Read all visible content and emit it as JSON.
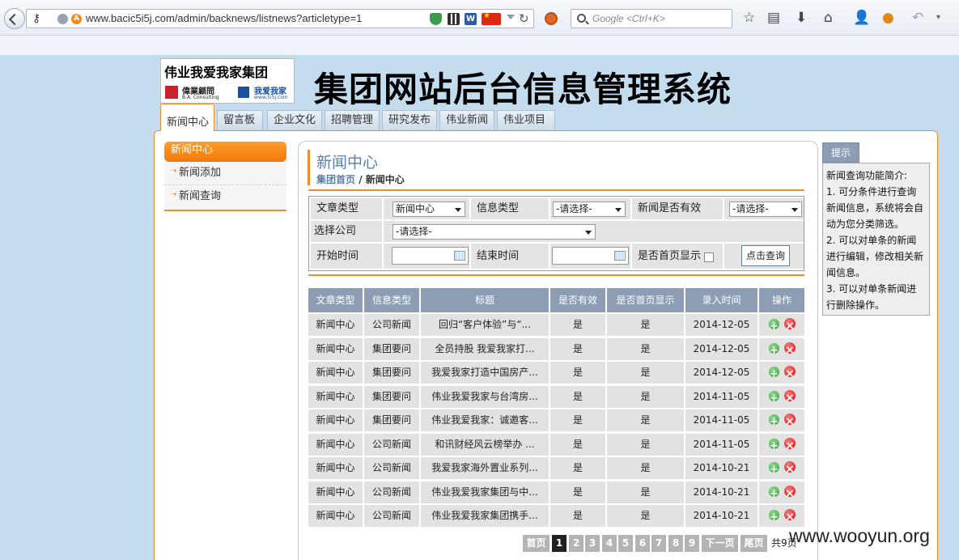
{
  "browser": {
    "url": "www.bacic5i5j.com/admin/backnews/listnews?articletype=1",
    "search_placeholder": "Google <Ctrl+K>",
    "favicon_letter": "A",
    "word_icon_letter": "W"
  },
  "logo": {
    "title": "伟业我爱我家集团",
    "brand_left": "偉業顧問",
    "brand_left_sub": "B.A. Consulting",
    "brand_right": "我爱我家",
    "brand_right_sub": "www.5i5j.com"
  },
  "site_title": "集团网站后台信息管理系统",
  "top_tabs": [
    "新闻中心",
    "留言板",
    "企业文化",
    "招聘管理",
    "研究发布",
    "伟业新闻",
    "伟业项目"
  ],
  "left_menu": {
    "header": "新闻中心",
    "items": [
      "新闻添加",
      "新闻查询"
    ]
  },
  "panel": {
    "title": "新闻中心",
    "breadcrumb_home": "集团首页",
    "breadcrumb_sep": " / ",
    "breadcrumb_current": "新闻中心"
  },
  "filter": {
    "article_type_label": "文章类型",
    "article_type_value": "新闻中心",
    "info_type_label": "信息类型",
    "info_type_value": "-请选择-",
    "valid_label": "新闻是否有效",
    "valid_value": "-请选择-",
    "company_label": "选择公司",
    "company_value": "-请选择-",
    "start_label": "开始时间",
    "start_value": "",
    "end_label": "结束时间",
    "end_value": "",
    "homepage_label": "是否首页显示",
    "homepage_checked": false,
    "query_button": "点击查询"
  },
  "table": {
    "columns": [
      "文章类型",
      "信息类型",
      "标题",
      "是否有效",
      "是否首页显示",
      "录入时间",
      "操作"
    ],
    "rows": [
      [
        "新闻中心",
        "公司新闻",
        "回归“客户体验”与“...",
        "是",
        "是",
        "2014-12-05"
      ],
      [
        "新闻中心",
        "集团要问",
        "全员持股 我爱我家打...",
        "是",
        "是",
        "2014-12-05"
      ],
      [
        "新闻中心",
        "集团要问",
        "我爱我家打造中国房产...",
        "是",
        "是",
        "2014-12-05"
      ],
      [
        "新闻中心",
        "集团要问",
        "伟业我爱我家与台湾房...",
        "是",
        "是",
        "2014-11-05"
      ],
      [
        "新闻中心",
        "集团要问",
        "伟业我爱我家：诚邀客...",
        "是",
        "是",
        "2014-11-05"
      ],
      [
        "新闻中心",
        "公司新闻",
        "和讯财经风云榜举办 ...",
        "是",
        "是",
        "2014-11-05"
      ],
      [
        "新闻中心",
        "公司新闻",
        "我爱我家海外置业系列...",
        "是",
        "是",
        "2014-10-21"
      ],
      [
        "新闻中心",
        "公司新闻",
        "伟业我爱我家集团与中...",
        "是",
        "是",
        "2014-10-21"
      ],
      [
        "新闻中心",
        "公司新闻",
        "伟业我爱我家集团携手...",
        "是",
        "是",
        "2014-10-21"
      ]
    ]
  },
  "pager": {
    "first": "首页",
    "pages": [
      "1",
      "2",
      "3",
      "4",
      "5",
      "6",
      "7",
      "8",
      "9"
    ],
    "current": "1",
    "next": "下一页",
    "last": "尾页",
    "total": "共9页"
  },
  "tips": {
    "tab": "提示",
    "lines": [
      "新闻查询功能简介:",
      "1. 可分条件进行查询新闻信息，系统将会自动为您分类筛选。",
      "2. 可以对单条的新闻进行编辑，修改相关新闻信息。",
      "3. 可以对单条新闻进行删除操作。"
    ]
  },
  "watermark": "www.wooyun.org",
  "colors": {
    "accent": "#f08c2a",
    "header_gray_blue": "#8d9db4",
    "page_bg": "#c3dcee"
  }
}
